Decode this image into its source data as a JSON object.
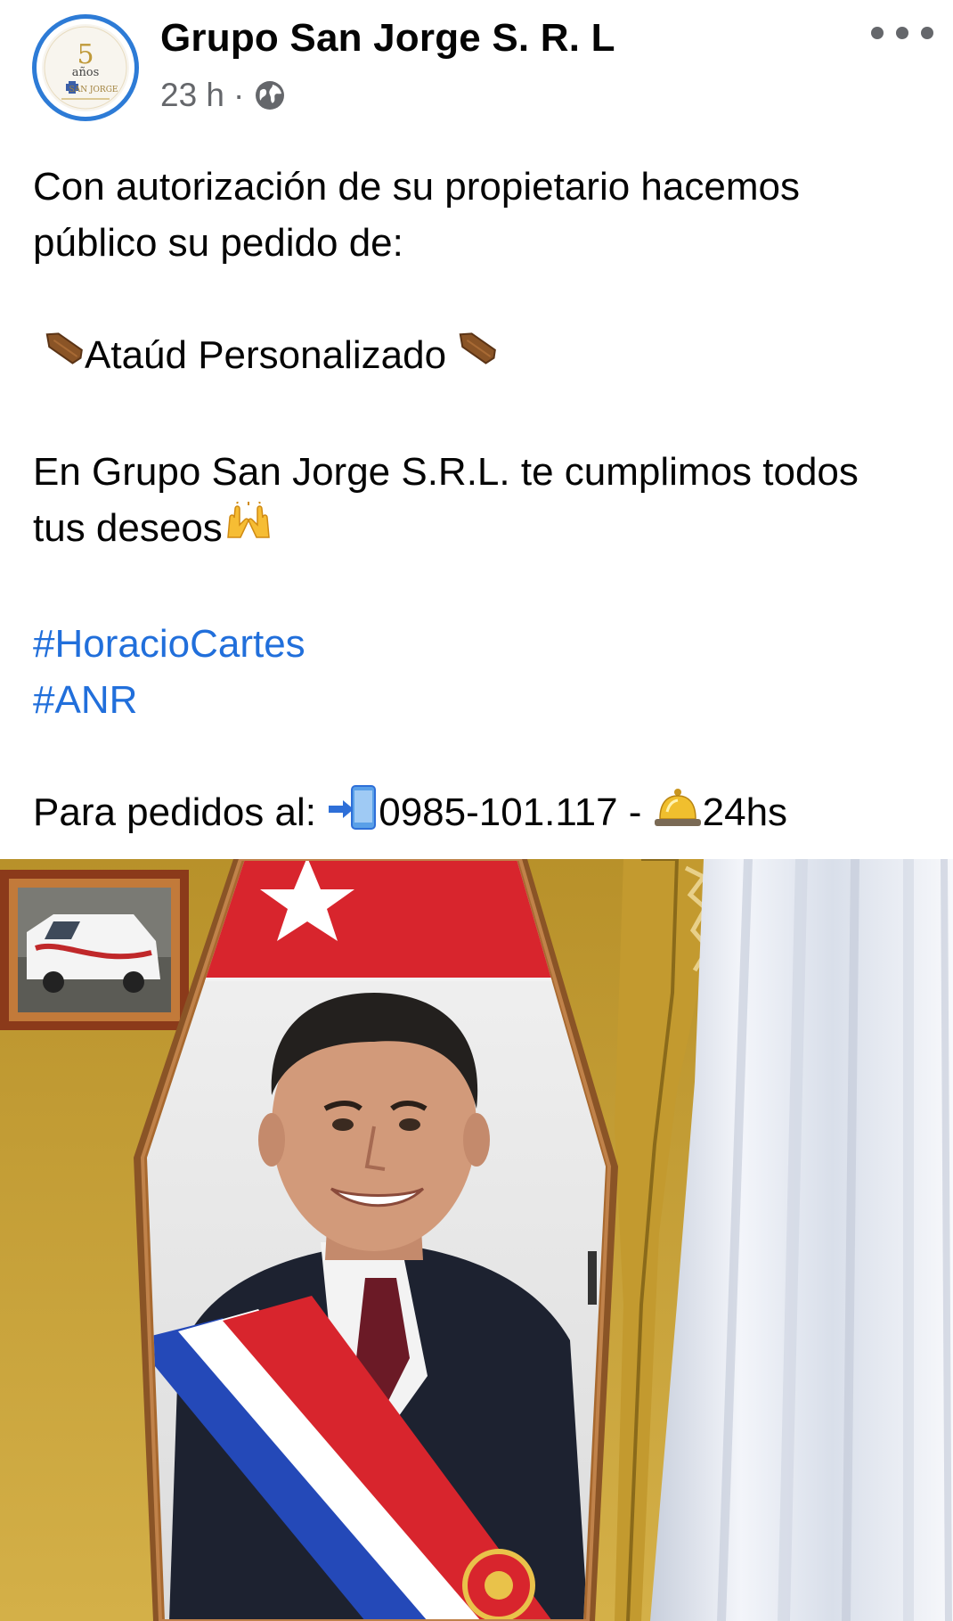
{
  "post": {
    "author": "Grupo San Jorge S. R. L",
    "time": "23 h",
    "separator": "·",
    "audience_icon": "globe-icon",
    "avatar": {
      "logo_number": "5",
      "logo_word": "años",
      "logo_brand": "SAN JORGE"
    },
    "lines": {
      "l1": "Con autorización de su propietario hacemos",
      "l2": "público su pedido de:",
      "l3": "Ataúd Personalizado",
      "l4": "En Grupo San Jorge S.R.L. te cumplimos todos",
      "l5": "tus deseos",
      "hashtag1": "#HoracioCartes",
      "hashtag2": "#ANR",
      "phone_prefix": "Para pedidos al: ",
      "phone_number": "0985-101.117 - ",
      "hours": "24hs"
    },
    "emojis": [
      "coffin-emoji",
      "raising-hands-emoji",
      "mobile-arrow-emoji",
      "bell-emoji"
    ],
    "photo": {
      "subject": "custom-coffin-with-portrait",
      "colors": {
        "wall": "#c9a43a",
        "flag_red": "#d8252d",
        "sash_blue": "#2449b8",
        "coffin_wood": "#8a5426"
      }
    }
  },
  "colors": {
    "hashtag": "#216fdb",
    "meta_text": "#65676b",
    "avatar_ring": "#2d7bd6"
  }
}
